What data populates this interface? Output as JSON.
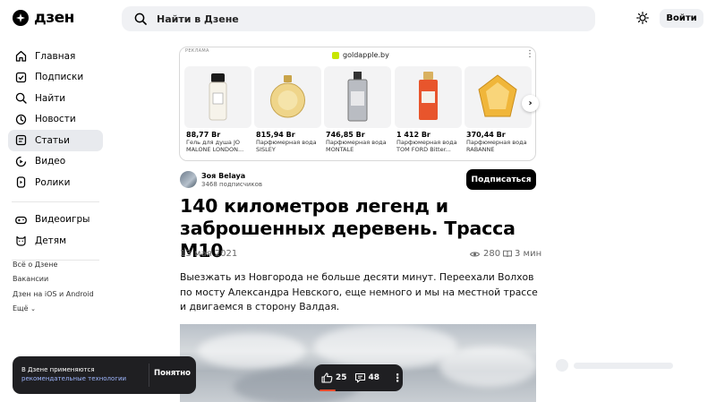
{
  "header": {
    "logo_text": "дзен",
    "search_placeholder": "Найти в Дзене",
    "login_label": "Войти"
  },
  "sidebar": {
    "items": [
      {
        "label": "Главная",
        "icon": "home-icon"
      },
      {
        "label": "Подписки",
        "icon": "subscriptions-icon"
      },
      {
        "label": "Найти",
        "icon": "search-icon"
      },
      {
        "label": "Новости",
        "icon": "news-icon"
      },
      {
        "label": "Статьи",
        "icon": "articles-icon",
        "active": true
      },
      {
        "label": "Видео",
        "icon": "video-icon"
      },
      {
        "label": "Ролики",
        "icon": "shorts-icon"
      }
    ],
    "items2": [
      {
        "label": "Видеоигры",
        "icon": "gamepad-icon"
      },
      {
        "label": "Детям",
        "icon": "kids-icon"
      }
    ],
    "footer": [
      "Всё о Дзене",
      "Вакансии",
      "Дзен на iOS и Android",
      "Ещё"
    ]
  },
  "ad": {
    "tag": "РЕКЛАМА",
    "source": "goldapple.by",
    "products": [
      {
        "price": "88,77 Br",
        "line1": "Гель для душа JO",
        "line2": "MALONE LONDON..."
      },
      {
        "price": "815,94 Br",
        "line1": "Парфюмерная вода",
        "line2": "SISLEY"
      },
      {
        "price": "746,85 Br",
        "line1": "Парфюмерная вода",
        "line2": "MONTALE"
      },
      {
        "price": "1 412 Br",
        "line1": "Парфюмерная вода",
        "line2": "TOM FORD Bitter..."
      },
      {
        "price": "370,44 Br",
        "line1": "Парфюмерная вода",
        "line2": "RABANNE"
      }
    ]
  },
  "author": {
    "name": "Зоя Belaya",
    "subscribers": "3468 подписчиков",
    "subscribe_label": "Подписаться"
  },
  "article": {
    "title": "140 километров легенд и заброшенных деревень. Трасса М10",
    "date": "13 мая 2021",
    "views": "280",
    "read_time": "3 мин",
    "lead": "Выезжать из Новгорода не больше десяти минут. Переехали Волхов по мосту Александра Невского, еще немного и мы на местной трассе и двигаемся в сторону Валдая."
  },
  "cookie": {
    "text": "В Дзене применяются",
    "link": "рекомендательные технологии",
    "button": "Понятно"
  },
  "actions": {
    "likes": "25",
    "comments": "48"
  },
  "colors": {
    "active_nav_bg": "#e8eaee",
    "search_bg": "#f0f1f4",
    "dark_panel": "#1f1f22",
    "accent_underline": "#e84a2c"
  }
}
